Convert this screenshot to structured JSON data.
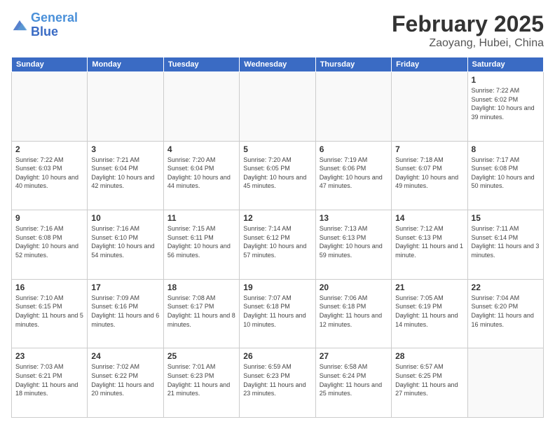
{
  "header": {
    "logo_line1": "General",
    "logo_line2": "Blue",
    "title": "February 2025",
    "subtitle": "Zaoyang, Hubei, China"
  },
  "weekdays": [
    "Sunday",
    "Monday",
    "Tuesday",
    "Wednesday",
    "Thursday",
    "Friday",
    "Saturday"
  ],
  "weeks": [
    [
      {
        "day": "",
        "info": ""
      },
      {
        "day": "",
        "info": ""
      },
      {
        "day": "",
        "info": ""
      },
      {
        "day": "",
        "info": ""
      },
      {
        "day": "",
        "info": ""
      },
      {
        "day": "",
        "info": ""
      },
      {
        "day": "1",
        "info": "Sunrise: 7:22 AM\nSunset: 6:02 PM\nDaylight: 10 hours and 39 minutes."
      }
    ],
    [
      {
        "day": "2",
        "info": "Sunrise: 7:22 AM\nSunset: 6:03 PM\nDaylight: 10 hours and 40 minutes."
      },
      {
        "day": "3",
        "info": "Sunrise: 7:21 AM\nSunset: 6:04 PM\nDaylight: 10 hours and 42 minutes."
      },
      {
        "day": "4",
        "info": "Sunrise: 7:20 AM\nSunset: 6:04 PM\nDaylight: 10 hours and 44 minutes."
      },
      {
        "day": "5",
        "info": "Sunrise: 7:20 AM\nSunset: 6:05 PM\nDaylight: 10 hours and 45 minutes."
      },
      {
        "day": "6",
        "info": "Sunrise: 7:19 AM\nSunset: 6:06 PM\nDaylight: 10 hours and 47 minutes."
      },
      {
        "day": "7",
        "info": "Sunrise: 7:18 AM\nSunset: 6:07 PM\nDaylight: 10 hours and 49 minutes."
      },
      {
        "day": "8",
        "info": "Sunrise: 7:17 AM\nSunset: 6:08 PM\nDaylight: 10 hours and 50 minutes."
      }
    ],
    [
      {
        "day": "9",
        "info": "Sunrise: 7:16 AM\nSunset: 6:08 PM\nDaylight: 10 hours and 52 minutes."
      },
      {
        "day": "10",
        "info": "Sunrise: 7:16 AM\nSunset: 6:10 PM\nDaylight: 10 hours and 54 minutes."
      },
      {
        "day": "11",
        "info": "Sunrise: 7:15 AM\nSunset: 6:11 PM\nDaylight: 10 hours and 56 minutes."
      },
      {
        "day": "12",
        "info": "Sunrise: 7:14 AM\nSunset: 6:12 PM\nDaylight: 10 hours and 57 minutes."
      },
      {
        "day": "13",
        "info": "Sunrise: 7:13 AM\nSunset: 6:13 PM\nDaylight: 10 hours and 59 minutes."
      },
      {
        "day": "14",
        "info": "Sunrise: 7:12 AM\nSunset: 6:13 PM\nDaylight: 11 hours and 1 minute."
      },
      {
        "day": "15",
        "info": "Sunrise: 7:11 AM\nSunset: 6:14 PM\nDaylight: 11 hours and 3 minutes."
      }
    ],
    [
      {
        "day": "16",
        "info": "Sunrise: 7:10 AM\nSunset: 6:15 PM\nDaylight: 11 hours and 5 minutes."
      },
      {
        "day": "17",
        "info": "Sunrise: 7:09 AM\nSunset: 6:16 PM\nDaylight: 11 hours and 6 minutes."
      },
      {
        "day": "18",
        "info": "Sunrise: 7:08 AM\nSunset: 6:17 PM\nDaylight: 11 hours and 8 minutes."
      },
      {
        "day": "19",
        "info": "Sunrise: 7:07 AM\nSunset: 6:18 PM\nDaylight: 11 hours and 10 minutes."
      },
      {
        "day": "20",
        "info": "Sunrise: 7:06 AM\nSunset: 6:18 PM\nDaylight: 11 hours and 12 minutes."
      },
      {
        "day": "21",
        "info": "Sunrise: 7:05 AM\nSunset: 6:19 PM\nDaylight: 11 hours and 14 minutes."
      },
      {
        "day": "22",
        "info": "Sunrise: 7:04 AM\nSunset: 6:20 PM\nDaylight: 11 hours and 16 minutes."
      }
    ],
    [
      {
        "day": "23",
        "info": "Sunrise: 7:03 AM\nSunset: 6:21 PM\nDaylight: 11 hours and 18 minutes."
      },
      {
        "day": "24",
        "info": "Sunrise: 7:02 AM\nSunset: 6:22 PM\nDaylight: 11 hours and 20 minutes."
      },
      {
        "day": "25",
        "info": "Sunrise: 7:01 AM\nSunset: 6:23 PM\nDaylight: 11 hours and 21 minutes."
      },
      {
        "day": "26",
        "info": "Sunrise: 6:59 AM\nSunset: 6:23 PM\nDaylight: 11 hours and 23 minutes."
      },
      {
        "day": "27",
        "info": "Sunrise: 6:58 AM\nSunset: 6:24 PM\nDaylight: 11 hours and 25 minutes."
      },
      {
        "day": "28",
        "info": "Sunrise: 6:57 AM\nSunset: 6:25 PM\nDaylight: 11 hours and 27 minutes."
      },
      {
        "day": "",
        "info": ""
      }
    ]
  ]
}
